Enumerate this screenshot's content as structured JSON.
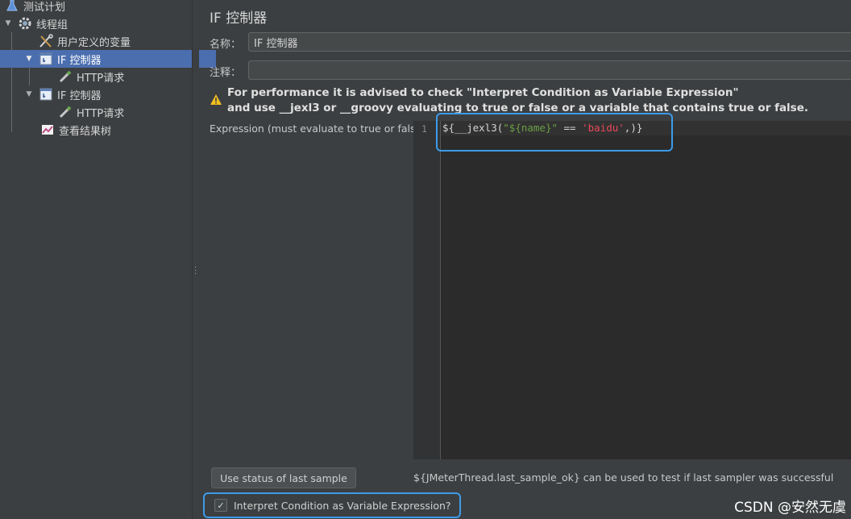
{
  "tree": {
    "items": [
      {
        "label": "测试计划",
        "icon": "flask-icon"
      },
      {
        "label": "线程组",
        "icon": "gear-icon"
      },
      {
        "label": "用户定义的变量",
        "icon": "tools-icon"
      },
      {
        "label": "IF 控制器",
        "icon": "if-controller-icon"
      },
      {
        "label": "HTTP请求",
        "icon": "pipette-icon"
      },
      {
        "label": "IF 控制器",
        "icon": "if-controller-icon"
      },
      {
        "label": "HTTP请求",
        "icon": "pipette-icon"
      },
      {
        "label": "查看结果树",
        "icon": "chart-icon"
      }
    ],
    "selected_index": 3
  },
  "panel": {
    "title": "IF 控制器",
    "name_label": "名称：",
    "name_value": "IF 控制器",
    "comment_label": "注释：",
    "comment_value": "",
    "warning_line1": "For performance it is advised to check \"Interpret Condition as Variable Expression\"",
    "warning_line2": "and use __jexl3 or __groovy evaluating to true or false or a variable that contains true or false.",
    "expression_label": "Expression (must evaluate to true or false)",
    "editor": {
      "line_number": "1",
      "code_prefix": "${__jexl3(",
      "code_str1": "\"${name}\"",
      "code_op": " == ",
      "code_str2": "'baidu'",
      "code_suffix": ",)}"
    },
    "use_status_button": "Use status of last sample",
    "hint": "${JMeterThread.last_sample_ok} can be used to test if last sampler was successful",
    "interpret_checkbox_label": "Interpret Condition as Variable Expression?",
    "interpret_checked": true,
    "interpret_check_glyph": "✓"
  },
  "watermark": "CSDN @安然无虞",
  "colors": {
    "background": "#3c3f41",
    "selection": "#4b6eaf",
    "highlight_border": "#3d9be9",
    "string_green": "#6a9f46",
    "string_red": "#e8485a",
    "warning_yellow": "#f0c020"
  }
}
